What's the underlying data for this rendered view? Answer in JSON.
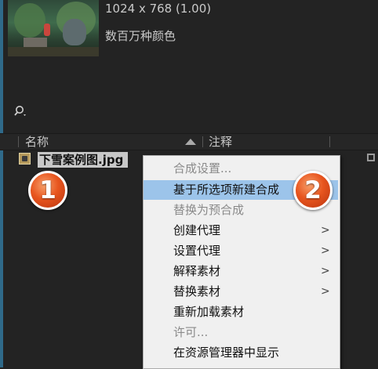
{
  "preview": {
    "resolution": "1024 x 768 (1.00)",
    "color_depth": "数百万种颜色"
  },
  "search": {
    "icon": "search-icon"
  },
  "columns": {
    "name": "名称",
    "notes": "注释"
  },
  "file": {
    "name": "下雪案例图.jpg",
    "icon": "image-file-icon"
  },
  "context_menu": {
    "items": [
      {
        "label": "合成设置...",
        "enabled": false
      },
      {
        "label": "基于所选项新建合成",
        "enabled": true,
        "highlighted": true
      },
      {
        "label": "替换为预合成",
        "enabled": false
      },
      {
        "label": "创建代理",
        "enabled": true,
        "submenu": ">"
      },
      {
        "label": "设置代理",
        "enabled": true,
        "submenu": ">"
      },
      {
        "label": "解释素材",
        "enabled": true,
        "submenu": ">"
      },
      {
        "label": "替换素材",
        "enabled": true,
        "submenu": ">"
      },
      {
        "label": "重新加载素材",
        "enabled": true
      },
      {
        "label": "许可...",
        "enabled": false
      },
      {
        "label": "在资源管理器中显示",
        "enabled": true
      }
    ]
  },
  "annotations": {
    "step1": "1",
    "step2": "2"
  }
}
